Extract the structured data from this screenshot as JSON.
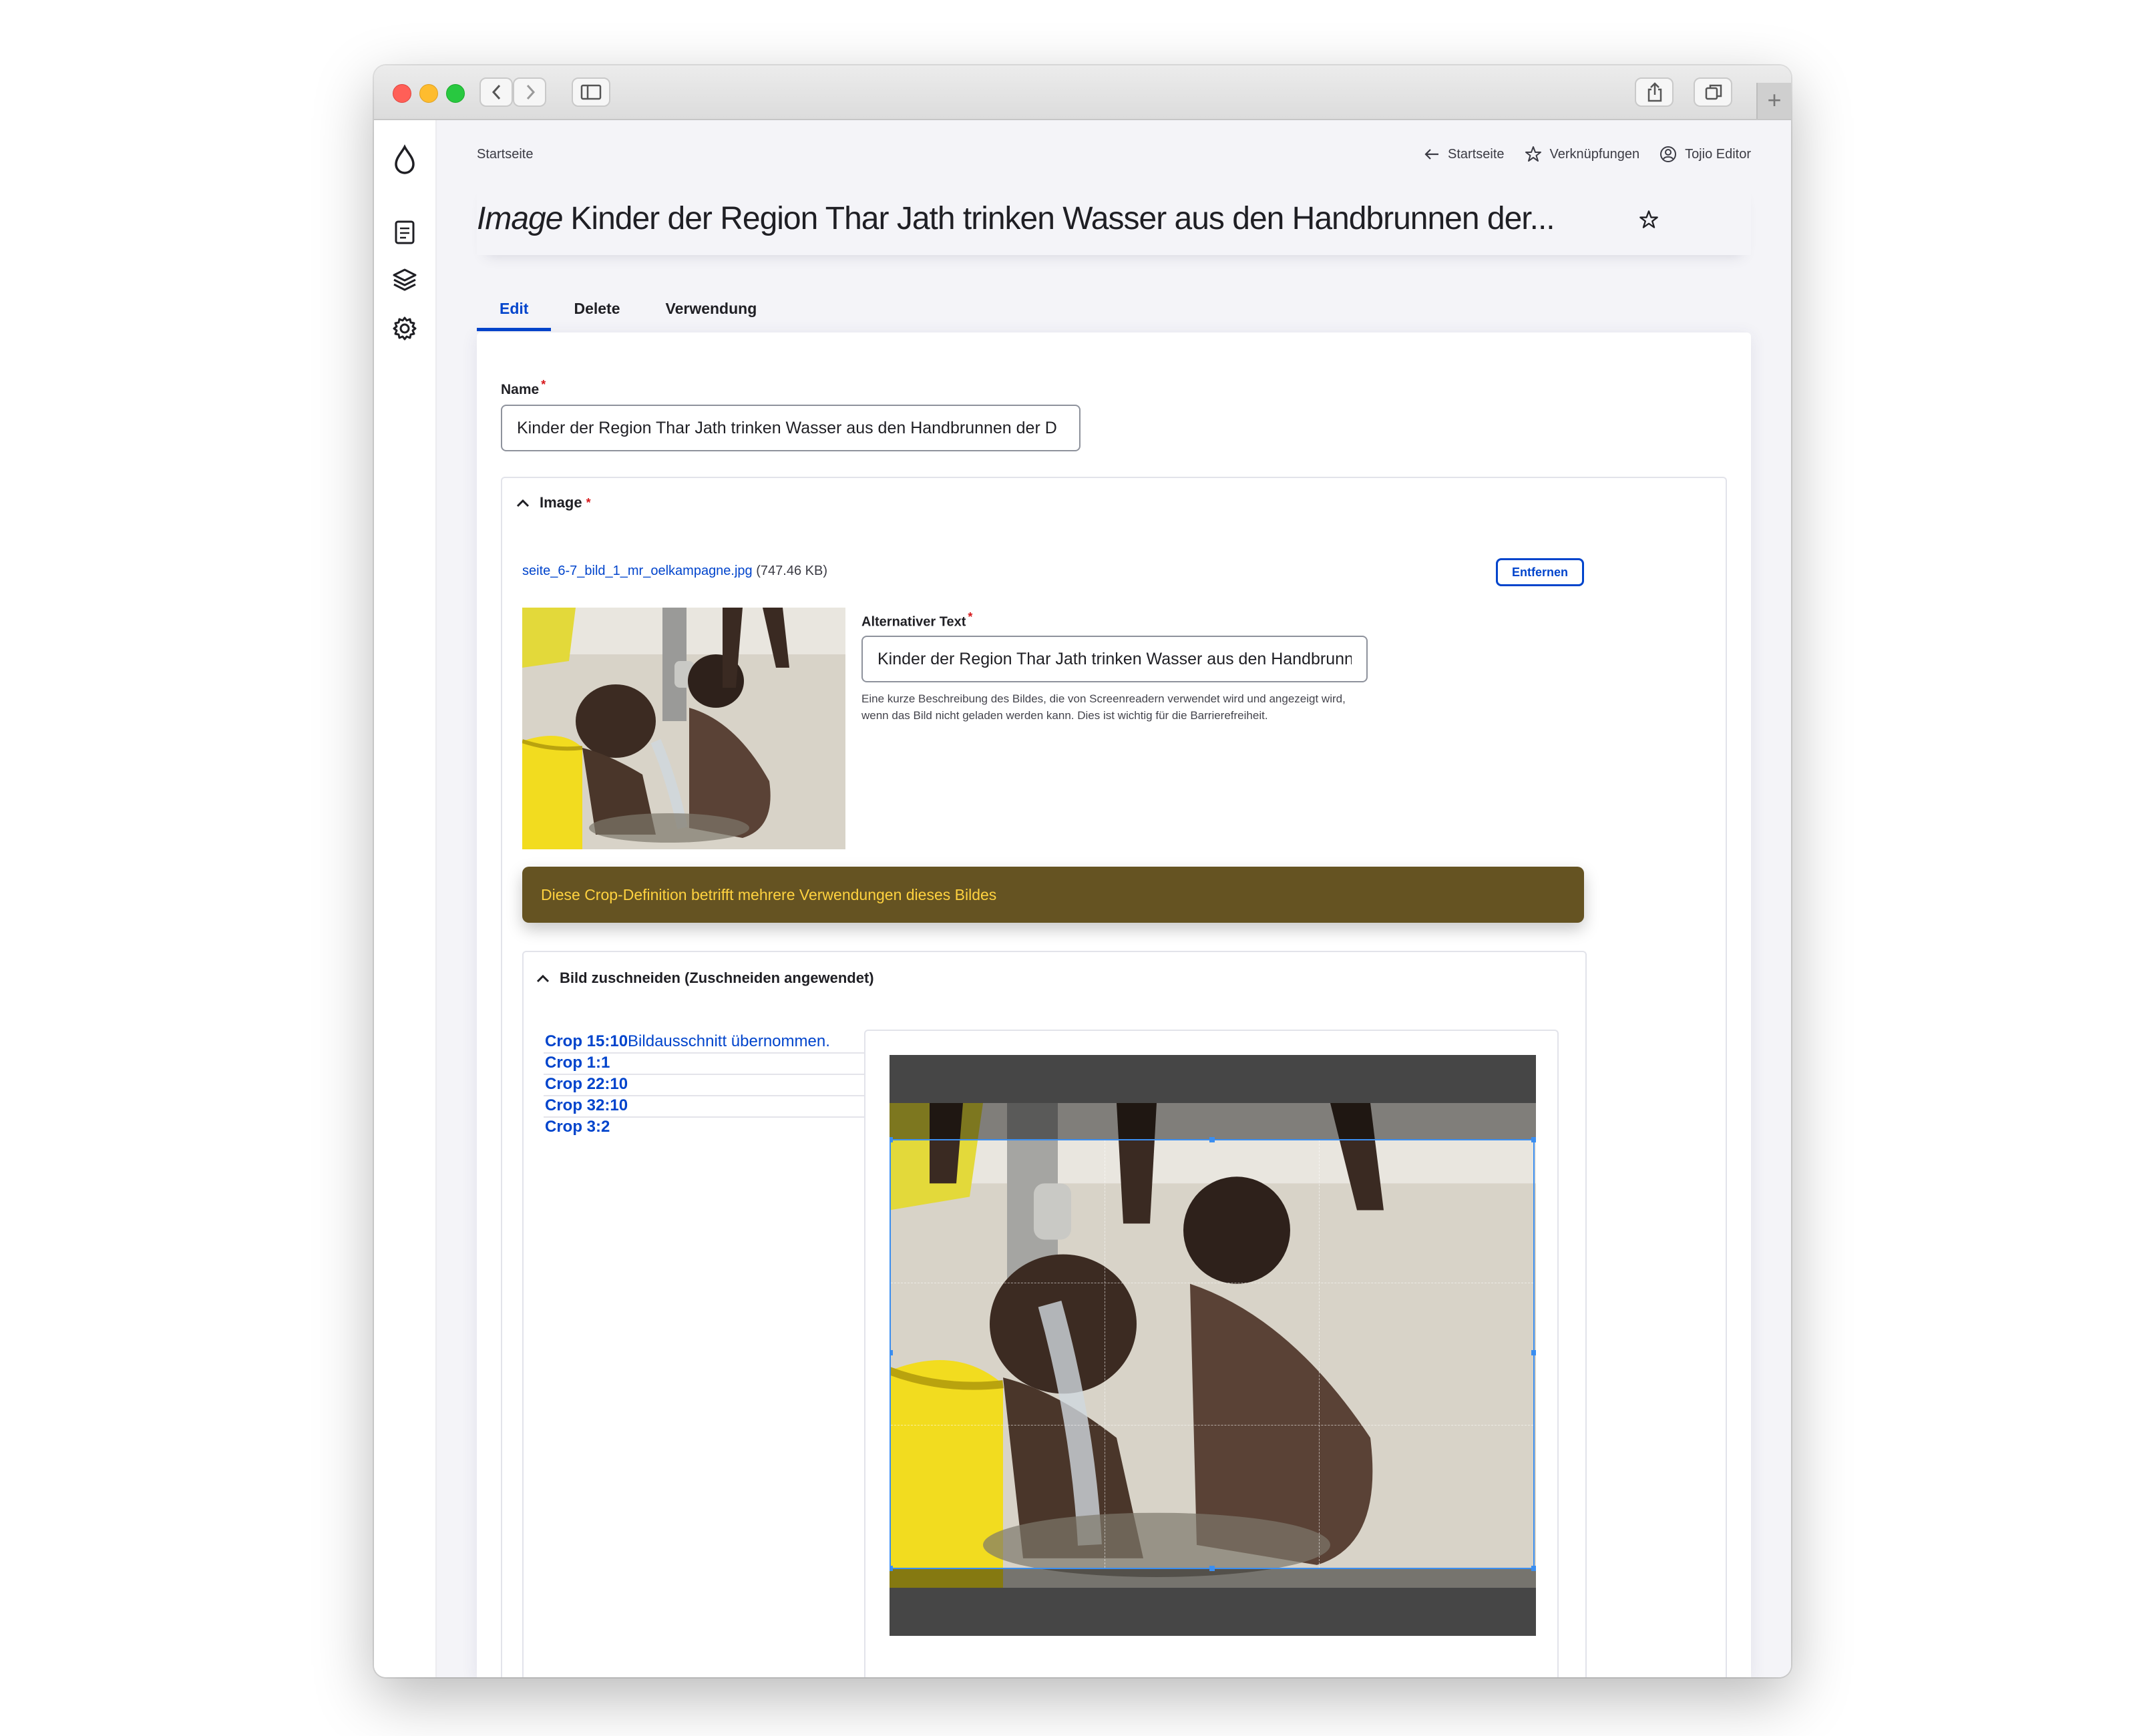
{
  "breadcrumb": "Startseite",
  "toplinks": {
    "back": "Startseite",
    "shortcuts": "Verknüpfungen",
    "user": "Tojio Editor"
  },
  "title": {
    "kind": "Image",
    "text": "Kinder der Region Thar Jath trinken Wasser aus den Handbrunnen der..."
  },
  "tabs": {
    "edit": "Edit",
    "delete": "Delete",
    "usage": "Verwendung"
  },
  "form": {
    "name_label": "Name",
    "name_value": "Kinder der Region Thar Jath trinken Wasser aus den Handbrunnen der D",
    "image_label": "Image",
    "file_name": "seite_6-7_bild_1_mr_oelkampagne.jpg",
    "file_size": "(747.46 KB)",
    "remove_button": "Entfernen",
    "alt_label": "Alternativer Text",
    "alt_value": "Kinder der Region Thar Jath trinken Wasser aus den Handbrunnen",
    "alt_description": "Eine kurze Beschreibung des Bildes, die von Screenreadern verwendet wird und angezeigt wird, wenn das Bild nicht geladen werden kann. Dies ist wichtig für die Barrierefreiheit.",
    "warning": "Diese Crop-Definition betrifft mehrere Verwendungen dieses Bildes",
    "crop_section": "Bild zuschneiden (Zuschneiden angewendet)",
    "crop_applied": "Bildausschnitt übernommen.",
    "crops": [
      "Crop 15:10",
      "Crop 1:1",
      "Crop 22:10",
      "Crop 32:10",
      "Crop 3:2"
    ]
  },
  "icons": {
    "logo": "drop-icon",
    "content": "document-icon",
    "structure": "layers-icon",
    "config": "gear-icon"
  },
  "colors": {
    "accent": "#0044cc",
    "warning_bg": "#655322",
    "warning_text": "#ffd23f",
    "required": "#d7191c"
  }
}
